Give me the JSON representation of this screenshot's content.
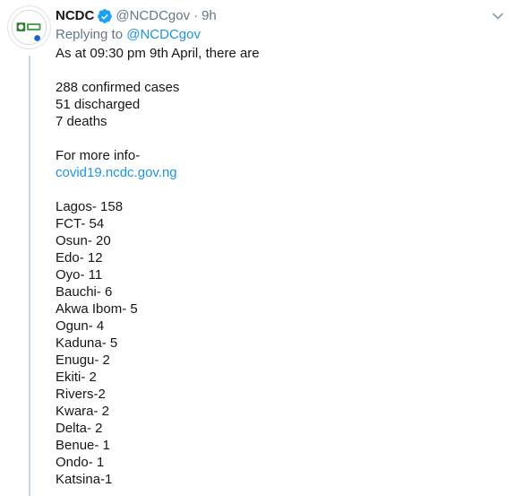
{
  "tweet": {
    "display_name": "NCDC",
    "handle": "@NCDCgov",
    "separator": "·",
    "time": "9h",
    "replying_prefix": "Replying to",
    "replying_handle": "@NCDCgov",
    "verified_icon": "verified-badge-icon",
    "menu_icon": "chevron-down-icon",
    "lines": {
      "l1": "As at 09:30 pm 9th April, there are",
      "l2": "288 confirmed cases",
      "l3": "51 discharged",
      "l4": "7 deaths",
      "l5": "For more info-",
      "link": "covid19.ncdc.gov.ng"
    },
    "states": [
      "Lagos- 158",
      "FCT- 54",
      "Osun- 20",
      "Edo- 12",
      "Oyo- 11",
      "Bauchi- 6",
      "Akwa Ibom- 5",
      "Ogun- 4",
      "Kaduna- 5",
      "Enugu- 2",
      "Ekiti- 2",
      "Rivers-2",
      "Kwara- 2",
      "Delta- 2",
      "Benue- 1",
      "Ondo- 1",
      "Katsina-1"
    ]
  },
  "colors": {
    "link": "#1b95e0",
    "secondary_text": "#657786",
    "primary_text": "#14171a",
    "thread_line": "#ccd6dd"
  }
}
